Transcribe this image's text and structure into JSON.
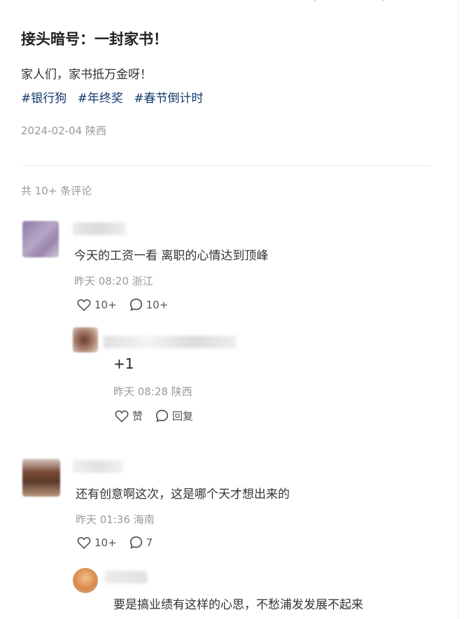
{
  "post": {
    "title": "接头暗号：一封家书！",
    "body": "家人们，家书抵万金呀！",
    "tags": [
      "#银行狗",
      "#年终奖",
      "#春节倒计时"
    ],
    "date_location": "2024-02-04 陕西"
  },
  "comments_header": {
    "count_text": "共 10+ 条评论"
  },
  "comments": [
    {
      "text": "今天的工资一看 离职的心情达到顶峰",
      "meta": "昨天 08:20 浙江",
      "likes": "10+",
      "replies": "10+"
    },
    {
      "text": "还有创意啊这次，这是哪个天才想出来的",
      "meta": "昨天 01:36 海南",
      "likes": "10+",
      "replies": "7"
    }
  ],
  "replies": [
    {
      "text": "+1",
      "meta": "昨天 08:28 陕西",
      "like_label": "赞",
      "reply_label": "回复"
    },
    {
      "text": "要是搞业绩有这样的心思，不愁浦发发展不起来"
    }
  ],
  "icons": {
    "like": "heart-outline-icon",
    "comment": "speech-bubble-icon"
  },
  "colors": {
    "tag": "#13386c",
    "meta": "#999999",
    "text": "#333333"
  }
}
